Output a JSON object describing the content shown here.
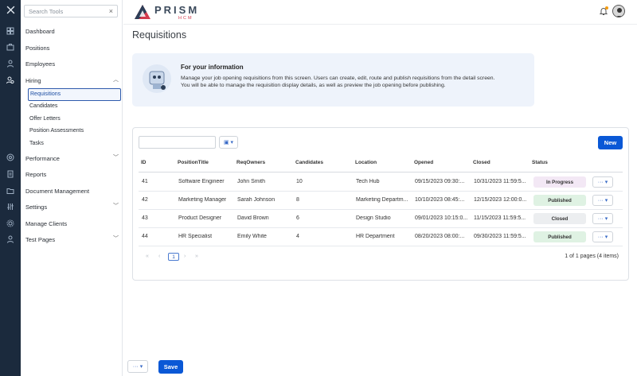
{
  "search": {
    "placeholder": "Search Tools",
    "clear": "×"
  },
  "nav": {
    "dashboard": "Dashboard",
    "positions": "Positions",
    "employees": "Employees",
    "hiring": "Hiring",
    "hiring_sub": [
      "Requisitions",
      "Candidates",
      "Offer Letters",
      "Position Assessments",
      "Tasks"
    ],
    "performance": "Performance",
    "reports": "Reports",
    "document_management": "Document Management",
    "settings": "Settings",
    "manage_clients": "Manage Clients",
    "test_pages": "Test Pages"
  },
  "brand": {
    "name": "PRISM",
    "sub": "HCM"
  },
  "page": {
    "title": "Requisitions"
  },
  "info": {
    "title": "For your information",
    "text": "Manage your job opening requisitions from this screen. Users can create, edit, route and publish requisitions from the detail screen. You will be able to manage the requisition display details, as well as preview the job opening before publishing."
  },
  "table": {
    "new_label": "New",
    "headers": [
      "ID",
      "PositionTitle",
      "ReqOwners",
      "Candidates",
      "Location",
      "Opened",
      "Closed",
      "Status"
    ],
    "rows": [
      {
        "id": "41",
        "title": "Software Engineer",
        "owner": "John Smith",
        "candidates": "10",
        "location": "Tech Hub",
        "opened": "09/15/2023 09:30:...",
        "closed": "10/31/2023 11:59:5...",
        "status": "In Progress"
      },
      {
        "id": "42",
        "title": "Marketing Manager",
        "owner": "Sarah Johnson",
        "candidates": "8",
        "location": "Marketing Departm...",
        "opened": "10/10/2023 08:45:...",
        "closed": "12/15/2023 12:00:0...",
        "status": "Published"
      },
      {
        "id": "43",
        "title": "Product Designer",
        "owner": "David Brown",
        "candidates": "6",
        "location": "Design Studio",
        "opened": "09/01/2023 10:15:0...",
        "closed": "11/15/2023 11:59:5...",
        "status": "Closed"
      },
      {
        "id": "44",
        "title": "HR Specialist",
        "owner": "Emily White",
        "candidates": "4",
        "location": "HR Department",
        "opened": "08/20/2023 08:00:...",
        "closed": "09/30/2023 11:59:5...",
        "status": "Published"
      }
    ],
    "row_action": "··· ▾",
    "pager": {
      "first": "«",
      "prev": "‹",
      "page": "1",
      "next": "›",
      "last": "»",
      "summary": "1 of 1 pages (4 items)"
    }
  },
  "footer": {
    "more": "··· ▾",
    "save": "Save"
  },
  "colors": {
    "rail": "#1b2a3d",
    "primary": "#0a58d6",
    "in_progress": "#f3e8f5",
    "published": "#dff2e3",
    "closed": "#eceef0"
  }
}
